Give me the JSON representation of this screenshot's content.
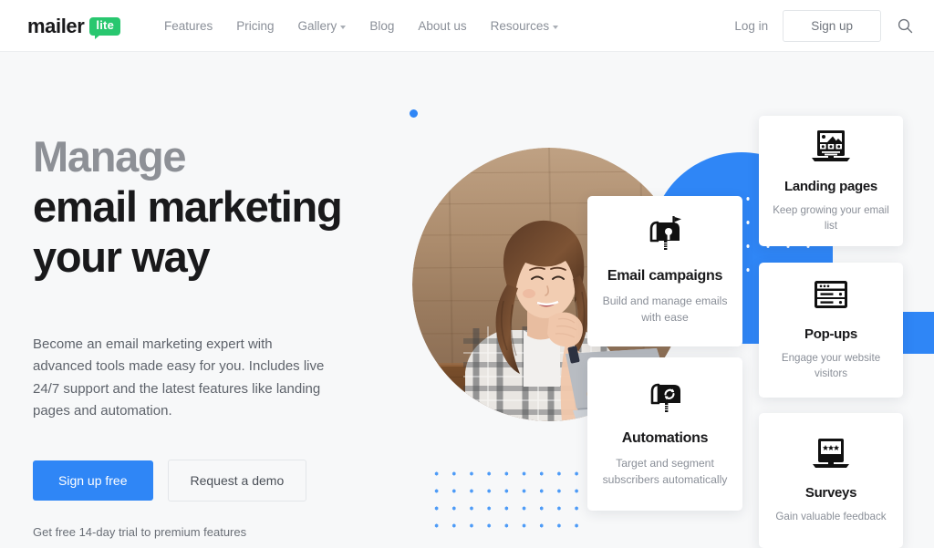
{
  "header": {
    "logo": {
      "word": "mailer",
      "badge": "lite"
    },
    "nav": [
      {
        "label": "Features",
        "has_chevron": false,
        "name": "nav-features"
      },
      {
        "label": "Pricing",
        "has_chevron": false,
        "name": "nav-pricing"
      },
      {
        "label": "Gallery",
        "has_chevron": true,
        "name": "nav-gallery"
      },
      {
        "label": "Blog",
        "has_chevron": false,
        "name": "nav-blog"
      },
      {
        "label": "About us",
        "has_chevron": false,
        "name": "nav-about-us"
      },
      {
        "label": "Resources",
        "has_chevron": true,
        "name": "nav-resources"
      }
    ],
    "login_label": "Log in",
    "signup_label": "Sign up",
    "search_icon": "search-icon"
  },
  "hero": {
    "headline_muted": "Manage",
    "headline_line2": "email marketing",
    "headline_line3": "your way",
    "paragraph": "Become an email marketing expert with advanced tools made easy for you. Includes live 24/7 support and the latest features like landing pages and automation.",
    "cta_primary": "Sign up free",
    "cta_secondary": "Request a demo",
    "trial_note": "Get free 14-day trial to premium features"
  },
  "cards": {
    "email": {
      "title": "Email campaigns",
      "subtitle": "Build and manage emails with ease",
      "icon": "mailbox-flag-icon"
    },
    "automations": {
      "title": "Automations",
      "subtitle": "Target and segment subscribers automatically",
      "icon": "mailbox-refresh-icon"
    },
    "landing": {
      "title": "Landing pages",
      "subtitle": "Keep growing your email list",
      "icon": "laptop-landing-page-icon"
    },
    "popups": {
      "title": "Pop-ups",
      "subtitle": "Engage your website visitors",
      "icon": "browser-window-icon"
    },
    "surveys": {
      "title": "Surveys",
      "subtitle": "Gain valuable feedback",
      "icon": "laptop-stars-icon"
    }
  },
  "colors": {
    "brand_blue": "#2f86f6",
    "brand_green": "#28c76f",
    "page_bg": "#f7f8f9",
    "headline_dark": "#19191b",
    "headline_muted": "#8d9096"
  },
  "photo": {
    "alt": "Smiling woman with curly brown hair in a plaid shirt working on a sticker-covered laptop at a wooden desk"
  }
}
